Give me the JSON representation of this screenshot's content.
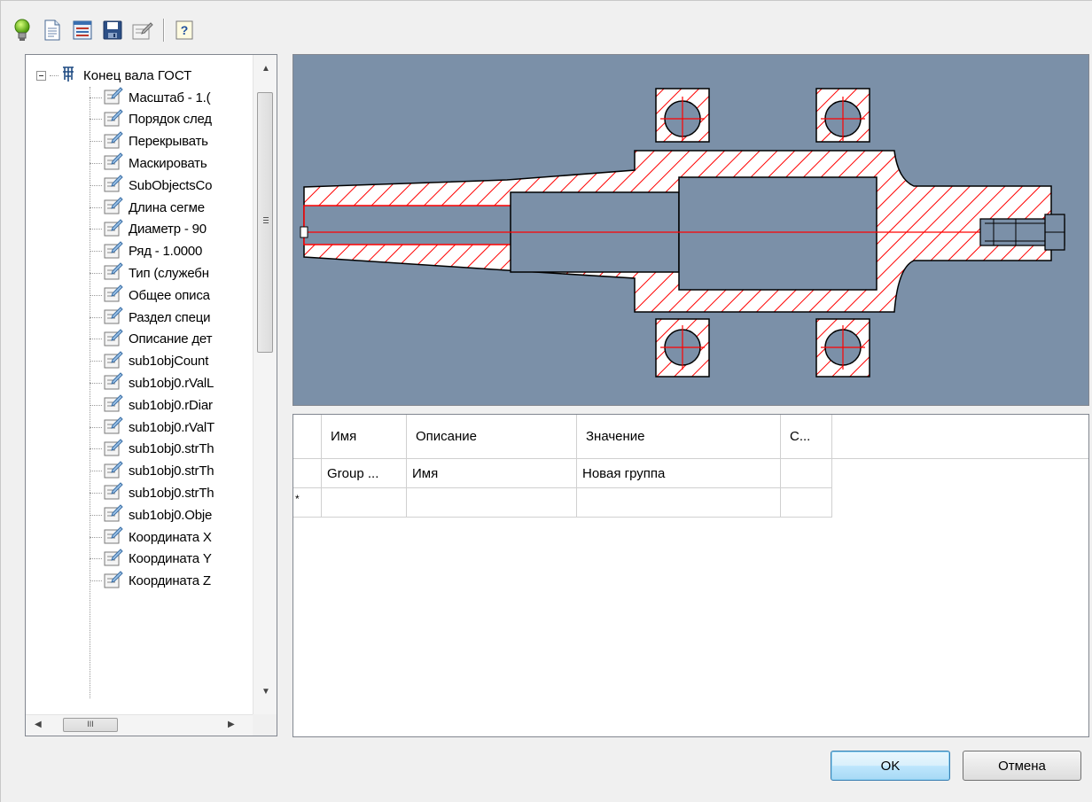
{
  "toolbar": {
    "buttons": [
      "lightbulb-icon",
      "new-document-icon",
      "properties-sheet-icon",
      "save-icon",
      "edit-properties-icon",
      "help-icon"
    ]
  },
  "tree": {
    "root_label": "Конец вала ГОСТ",
    "items": [
      "Масштаб - 1.(",
      "Порядок след",
      "Перекрывать",
      "Маскировать",
      "SubObjectsCo",
      "Длина сегме",
      "Диаметр - 90",
      "Ряд - 1.0000",
      "Тип (служебн",
      "Общее описа",
      "Раздел специ",
      "Описание дет",
      "sub1objCount",
      "sub1obj0.rValL",
      "sub1obj0.rDiar",
      "sub1obj0.rValT",
      "sub1obj0.strTh",
      "sub1obj0.strTh",
      "sub1obj0.strTh",
      "sub1obj0.Obje",
      "Координата X",
      "Координата Y",
      "Координата Z"
    ],
    "hscroll_grip": "III"
  },
  "grid": {
    "columns": [
      "Имя",
      "Описание",
      "Значение",
      "С..."
    ],
    "rows": [
      {
        "name": "Group ...",
        "description": "Имя",
        "value": "Новая группа",
        "extra": ""
      }
    ],
    "new_row_marker": "*"
  },
  "buttons": {
    "ok": "OK",
    "cancel": "Отмена"
  },
  "colors": {
    "preview_background": "#7b90a8",
    "hatch": "#ff0000",
    "outline": "#000000"
  }
}
